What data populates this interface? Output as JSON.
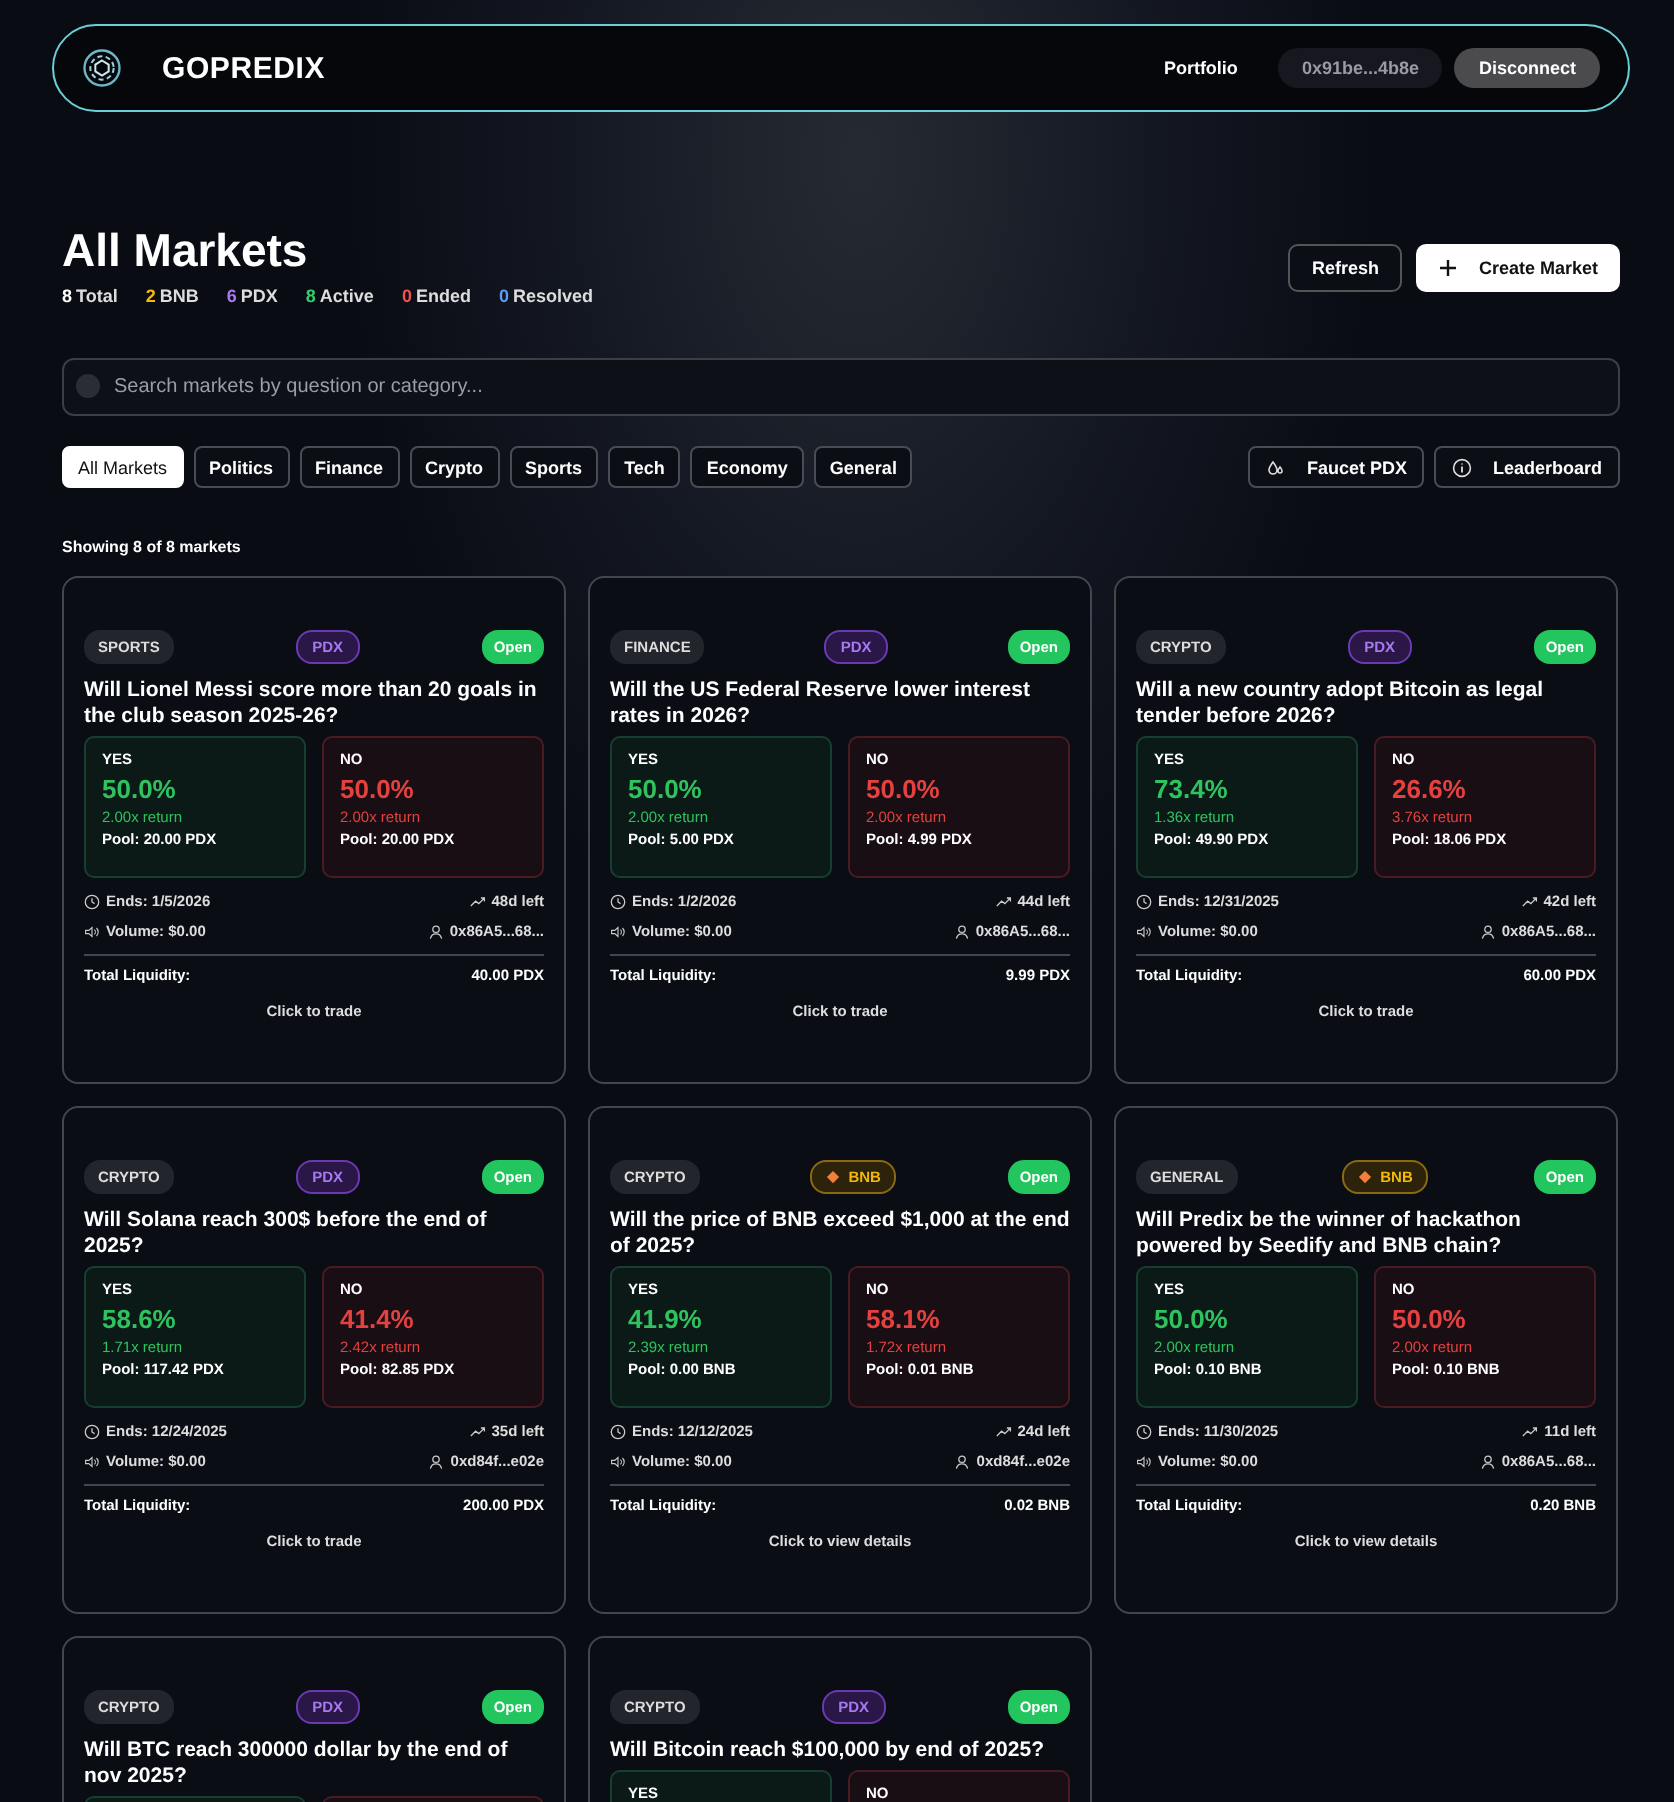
{
  "header": {
    "brand": "GOPREDIX",
    "portfolio": "Portfolio",
    "wallet": "0x91be...4b8e",
    "disconnect": "Disconnect"
  },
  "page": {
    "title": "All Markets",
    "refresh": "Refresh",
    "create": "Create Market"
  },
  "stats": [
    {
      "count": "8",
      "name": "Total",
      "color": "#ffffff"
    },
    {
      "count": "2",
      "name": "BNB",
      "color": "#f0b90b"
    },
    {
      "count": "6",
      "name": "PDX",
      "color": "#a779f0"
    },
    {
      "count": "8",
      "name": "Active",
      "color": "#2fd06a"
    },
    {
      "count": "0",
      "name": "Ended",
      "color": "#f05252"
    },
    {
      "count": "0",
      "name": "Resolved",
      "color": "#5b9cf5"
    }
  ],
  "search": {
    "placeholder": "Search markets by question or category..."
  },
  "filters": [
    {
      "label": "All Markets",
      "selected": true
    },
    {
      "label": "Politics",
      "selected": false
    },
    {
      "label": "Finance",
      "selected": false
    },
    {
      "label": "Crypto",
      "selected": false
    },
    {
      "label": "Sports",
      "selected": false
    },
    {
      "label": "Tech",
      "selected": false
    },
    {
      "label": "Economy",
      "selected": false
    },
    {
      "label": "General",
      "selected": false
    }
  ],
  "actions": {
    "faucet": "Faucet PDX",
    "leaderboard": "Leaderboard"
  },
  "showing": "Showing 8 of 8 markets",
  "markets": [
    {
      "category": "SPORTS",
      "token": {
        "kind": "pdx",
        "label": "PDX"
      },
      "status": {
        "kind": "open",
        "label": "Open"
      },
      "question": "Will Lionel Messi score more than 20 goals in the club season 2025-26?",
      "outcomes": [
        {
          "kind": "yes",
          "label": "YES",
          "percent": "50.0%",
          "return": "2.00x return",
          "pool": "Pool: 20.00 PDX"
        },
        {
          "kind": "no",
          "label": "NO",
          "percent": "50.0%",
          "return": "2.00x return",
          "pool": "Pool: 20.00 PDX"
        }
      ],
      "ends": "Ends: 1/5/2026",
      "left": "48d left",
      "volume": "Volume: $0.00",
      "creator": "0x86A5...68...",
      "liquidity_label": "Total Liquidity:",
      "liquidity": "40.00 PDX",
      "footer": "Click to trade"
    },
    {
      "category": "FINANCE",
      "token": {
        "kind": "pdx",
        "label": "PDX"
      },
      "status": {
        "kind": "open",
        "label": "Open"
      },
      "question": "Will the US Federal Reserve lower interest rates in 2026?",
      "outcomes": [
        {
          "kind": "yes",
          "label": "YES",
          "percent": "50.0%",
          "return": "2.00x return",
          "pool": "Pool: 5.00 PDX"
        },
        {
          "kind": "no",
          "label": "NO",
          "percent": "50.0%",
          "return": "2.00x return",
          "pool": "Pool: 4.99 PDX"
        }
      ],
      "ends": "Ends: 1/2/2026",
      "left": "44d left",
      "volume": "Volume: $0.00",
      "creator": "0x86A5...68...",
      "liquidity_label": "Total Liquidity:",
      "liquidity": "9.99 PDX",
      "footer": "Click to trade"
    },
    {
      "category": "CRYPTO",
      "token": {
        "kind": "pdx",
        "label": "PDX"
      },
      "status": {
        "kind": "open",
        "label": "Open"
      },
      "question": "Will a new country adopt Bitcoin as legal tender before 2026?",
      "outcomes": [
        {
          "kind": "yes",
          "label": "YES",
          "percent": "73.4%",
          "return": "1.36x return",
          "pool": "Pool: 49.90 PDX"
        },
        {
          "kind": "no",
          "label": "NO",
          "percent": "26.6%",
          "return": "3.76x return",
          "pool": "Pool: 18.06 PDX"
        }
      ],
      "ends": "Ends: 12/31/2025",
      "left": "42d left",
      "volume": "Volume: $0.00",
      "creator": "0x86A5...68...",
      "liquidity_label": "Total Liquidity:",
      "liquidity": "60.00 PDX",
      "footer": "Click to trade"
    },
    {
      "category": "CRYPTO",
      "token": {
        "kind": "pdx",
        "label": "PDX"
      },
      "status": {
        "kind": "open",
        "label": "Open"
      },
      "question": "Will Solana reach 300$ before the end of 2025?",
      "outcomes": [
        {
          "kind": "yes",
          "label": "YES",
          "percent": "58.6%",
          "return": "1.71x return",
          "pool": "Pool: 117.42 PDX"
        },
        {
          "kind": "no",
          "label": "NO",
          "percent": "41.4%",
          "return": "2.42x return",
          "pool": "Pool: 82.85 PDX"
        }
      ],
      "ends": "Ends: 12/24/2025",
      "left": "35d left",
      "volume": "Volume: $0.00",
      "creator": "0xd84f...e02e",
      "liquidity_label": "Total Liquidity:",
      "liquidity": "200.00 PDX",
      "footer": "Click to trade"
    },
    {
      "category": "CRYPTO",
      "token": {
        "kind": "bnb",
        "label": "BNB"
      },
      "status": {
        "kind": "open",
        "label": "Open"
      },
      "question": "Will the price of BNB exceed $1,000 at the end of 2025?",
      "outcomes": [
        {
          "kind": "yes",
          "label": "YES",
          "percent": "41.9%",
          "return": "2.39x return",
          "pool": "Pool: 0.00 BNB"
        },
        {
          "kind": "no",
          "label": "NO",
          "percent": "58.1%",
          "return": "1.72x return",
          "pool": "Pool: 0.01 BNB"
        }
      ],
      "ends": "Ends: 12/12/2025",
      "left": "24d left",
      "volume": "Volume: $0.00",
      "creator": "0xd84f...e02e",
      "liquidity_label": "Total Liquidity:",
      "liquidity": "0.02 BNB",
      "footer": "Click to view details"
    },
    {
      "category": "GENERAL",
      "token": {
        "kind": "bnb",
        "label": "BNB"
      },
      "status": {
        "kind": "open",
        "label": "Open"
      },
      "question": "Will Predix be the winner of hackathon powered by Seedify and BNB chain?",
      "outcomes": [
        {
          "kind": "yes",
          "label": "YES",
          "percent": "50.0%",
          "return": "2.00x return",
          "pool": "Pool: 0.10 BNB"
        },
        {
          "kind": "no",
          "label": "NO",
          "percent": "50.0%",
          "return": "2.00x return",
          "pool": "Pool: 0.10 BNB"
        }
      ],
      "ends": "Ends: 11/30/2025",
      "left": "11d left",
      "volume": "Volume: $0.00",
      "creator": "0x86A5...68...",
      "liquidity_label": "Total Liquidity:",
      "liquidity": "0.20 BNB",
      "footer": "Click to view details"
    },
    {
      "category": "CRYPTO",
      "token": {
        "kind": "pdx",
        "label": "PDX"
      },
      "status": {
        "kind": "open",
        "label": "Open"
      },
      "question": "Will BTC reach 300000 dollar by the end of nov 2025?",
      "outcomes": [
        {
          "kind": "yes"
        },
        {
          "kind": "no"
        }
      ]
    },
    {
      "category": "CRYPTO",
      "token": {
        "kind": "pdx",
        "label": "PDX"
      },
      "status": {
        "kind": "open",
        "label": "Open"
      },
      "question": "Will Bitcoin reach $100,000 by end of 2025?",
      "outcomes": [
        {
          "kind": "yes",
          "label": "YES"
        },
        {
          "kind": "no",
          "label": "NO"
        }
      ]
    }
  ]
}
